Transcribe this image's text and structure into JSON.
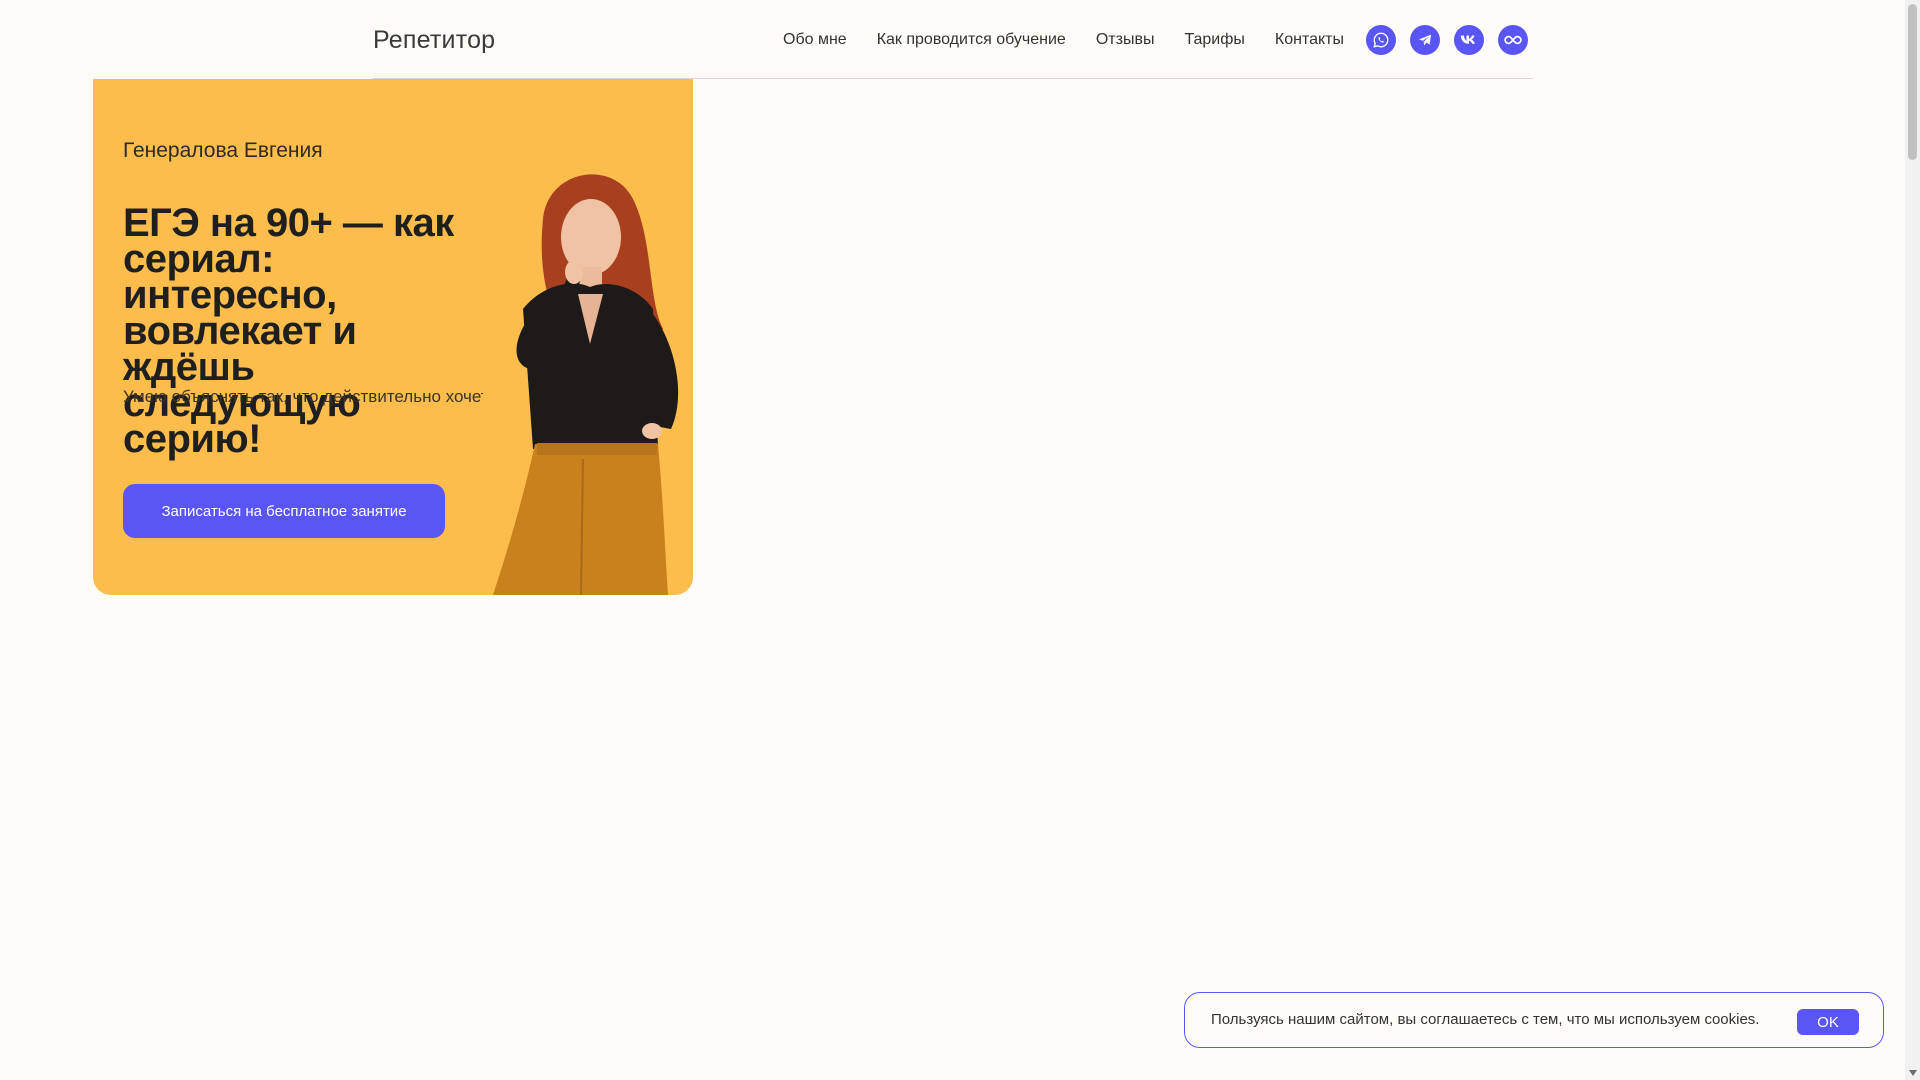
{
  "header": {
    "brand": "Репетитор",
    "nav": [
      {
        "label": "Обо мне"
      },
      {
        "label": "Как проводится обучение"
      },
      {
        "label": "Отзывы"
      },
      {
        "label": "Тарифы"
      },
      {
        "label": "Контакты"
      }
    ],
    "socials": [
      {
        "icon": "whatsapp-icon"
      },
      {
        "icon": "telegram-icon"
      },
      {
        "icon": "vk-icon"
      },
      {
        "icon": "max-icon"
      }
    ]
  },
  "hero": {
    "name": "Генералова Евгения",
    "title": "ЕГЭ на 90+ — как сериал: интересно, вовлекает и ждёшь следующую серию!",
    "subtitle": "Умею объяснять так, что действительно хочется",
    "cta_label": "Записаться на бесплатное занятие"
  },
  "cookie": {
    "text": "Пользуясь нашим сайтом, вы соглашаетесь с тем, что мы используем cookies.",
    "ok_label": "OK"
  },
  "colors": {
    "accent": "#5a56f6",
    "hero_bg": "#fdbd4c",
    "page_bg": "#fffcf8"
  }
}
